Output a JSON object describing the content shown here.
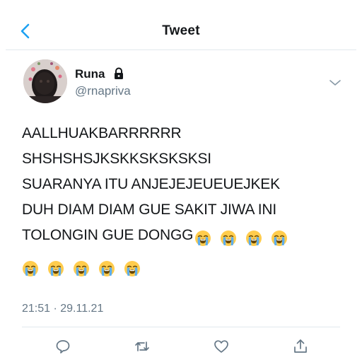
{
  "header": {
    "title": "Tweet",
    "back_icon": "chevron-left-icon"
  },
  "author": {
    "name": "Runa",
    "handle": "@rnapriva",
    "protected_icon": "lock-icon",
    "menu_icon": "chevron-down-icon"
  },
  "tweet": {
    "lines": [
      "AALLHUAKBARRRRRR",
      "SHSHSHSJKSKKSKSKSKSI",
      "SUARANYA ITU ANJEJEJEUEUEJKEK",
      "DUH DIAM DIAM GUE SAKIT JIWA INI",
      "TOLONGIN GUE DONGG"
    ],
    "emoji_name": "loudly-crying-face",
    "emoji_inline_count": 4,
    "emoji_line_count": 5,
    "timestamp": "21:51 · 29.11.21"
  },
  "actions": [
    {
      "name": "reply",
      "icon": "comment-icon"
    },
    {
      "name": "retweet",
      "icon": "retweet-icon"
    },
    {
      "name": "like",
      "icon": "heart-icon"
    },
    {
      "name": "share",
      "icon": "share-icon"
    }
  ],
  "colors": {
    "accent": "#1da1f2",
    "text": "#14171a",
    "secondary": "#657786",
    "divider": "#e1e8ed"
  }
}
